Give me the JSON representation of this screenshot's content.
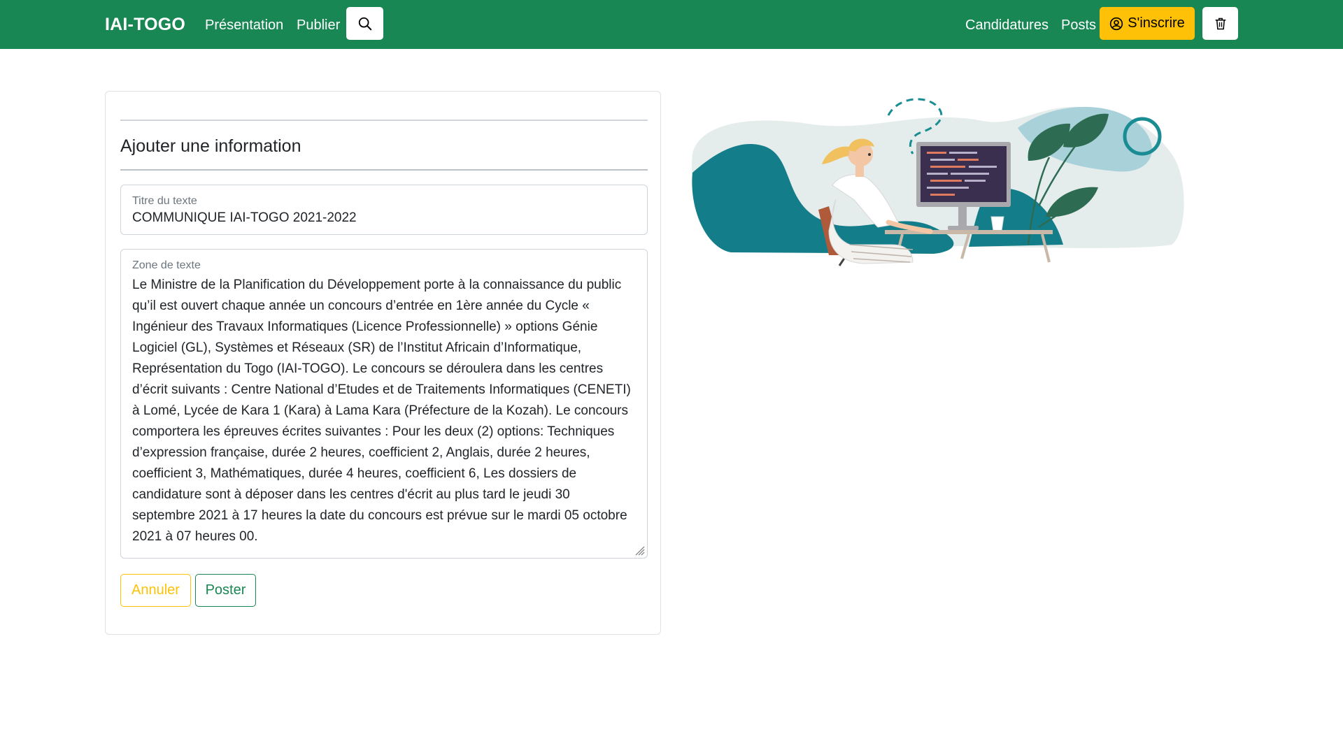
{
  "navbar": {
    "brand": "IAI-TOGO",
    "links": [
      {
        "label": "Présentation"
      },
      {
        "label": "Publier"
      },
      {
        "label": "Candidatures"
      },
      {
        "label": "Posts"
      }
    ],
    "signup_label": "S'inscrire",
    "colors": {
      "background": "#198754",
      "signup": "#ffc107"
    }
  },
  "form": {
    "heading": "Ajouter une information",
    "title_field": {
      "label": "Titre du texte",
      "value": "COMMUNIQUE IAI-TOGO 2021-2022"
    },
    "text_field": {
      "label": "Zone de texte",
      "value": "Le Ministre de la Planification du Développement porte à la connaissance du public qu’il est ouvert chaque année un concours d’entrée en 1ère année du Cycle « Ingénieur des Travaux Informatiques (Licence Professionnelle) » options Génie Logiciel (GL), Systèmes et Réseaux (SR) de l’Institut Africain d’Informatique, Représentation du Togo (IAI-TOGO). Le concours se déroulera dans les centres d’écrit suivants : Centre National d’Etudes et de Traitements Informatiques (CENETI) à Lomé, Lycée de Kara 1 (Kara) à Lama Kara (Préfecture de la Kozah). Le concours comportera les épreuves écrites suivantes : Pour les deux (2) options: Techniques d’expression française, durée 2 heures, coefficient 2, Anglais, durée 2 heures, coefficient 3, Mathématiques, durée 4 heures, coefficient 6, Les dossiers de candidature sont à déposer dans les centres d'écrit au plus tard le jeudi 30 septembre 2021 à 17 heures la date du concours est prévue sur le mardi 05 octobre 2021 à 07 heures 00."
    },
    "cancel_label": "Annuler",
    "post_label": "Poster"
  },
  "icons": {
    "search": "search-icon",
    "signup": "user-circle-icon",
    "trash": "trash-icon"
  }
}
